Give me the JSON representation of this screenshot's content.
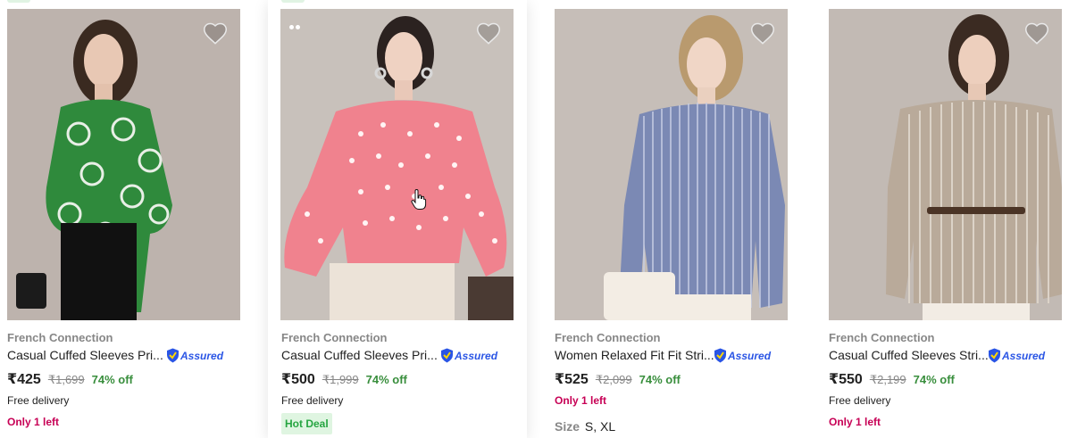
{
  "products": [
    {
      "brand": "French Connection",
      "title": "Casual Cuffed Sleeves Pri...",
      "assured": "Assured",
      "price": "₹425",
      "mrp": "₹1,699",
      "off": "74% off",
      "delivery": "Free delivery",
      "stock": "Only 1 left",
      "image": "woman-green-printed-wrap-top",
      "colors": {
        "garment": "#2f8a3c",
        "pattern": "#e8efe6",
        "bottom": "#111111",
        "bg": "#bdb3ad"
      }
    },
    {
      "brand": "French Connection",
      "title": "Casual Cuffed Sleeves Pri...",
      "assured": "Assured",
      "price": "₹500",
      "mrp": "₹1,999",
      "off": "74% off",
      "delivery": "Free delivery",
      "deal": "Hot Deal",
      "image": "woman-pink-printed-top",
      "colors": {
        "garment": "#f0828e",
        "pattern": "#fff4f4",
        "bottom": "#ece3d8",
        "bg": "#c8c1bb"
      }
    },
    {
      "brand": "French Connection",
      "title": "Women Relaxed Fit Fit Stri...",
      "assured": "Assured",
      "price": "₹525",
      "mrp": "₹2,099",
      "off": "74% off",
      "stock": "Only 1 left",
      "size_label": "Size",
      "sizes": "S, XL",
      "image": "woman-blue-striped-shirt",
      "colors": {
        "garment": "#7b89b4",
        "pattern": "#c7cee3",
        "bottom": "#f3ede4",
        "bg": "#c6beb8"
      }
    },
    {
      "brand": "French Connection",
      "title": "Casual Cuffed Sleeves Stri...",
      "assured": "Assured",
      "price": "₹550",
      "mrp": "₹2,199",
      "off": "74% off",
      "delivery": "Free delivery",
      "stock": "Only 1 left",
      "image": "woman-beige-striped-belted-top",
      "colors": {
        "garment": "#b9aa9a",
        "pattern": "#dcd3c8",
        "bottom": "#f2ece4",
        "bg": "#c2bab4"
      }
    }
  ]
}
